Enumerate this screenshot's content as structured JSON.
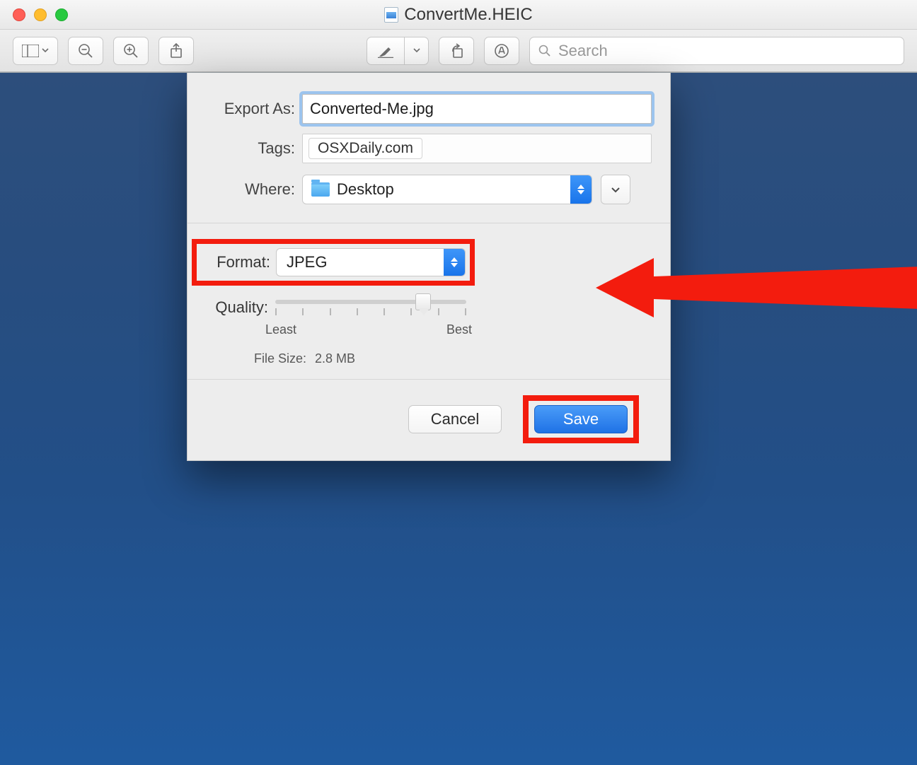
{
  "window": {
    "title": "ConvertMe.HEIC"
  },
  "toolbar": {
    "search_placeholder": "Search"
  },
  "export": {
    "labels": {
      "export_as": "Export As:",
      "tags": "Tags:",
      "where": "Where:",
      "format": "Format:",
      "quality": "Quality:",
      "filesize": "File Size:"
    },
    "export_as_value": "Converted-Me.jpg",
    "tag_value": "OSXDaily.com",
    "where_value": "Desktop",
    "format_value": "JPEG",
    "quality": {
      "least": "Least",
      "best": "Best"
    },
    "filesize_value": "2.8 MB",
    "buttons": {
      "cancel": "Cancel",
      "save": "Save"
    }
  }
}
